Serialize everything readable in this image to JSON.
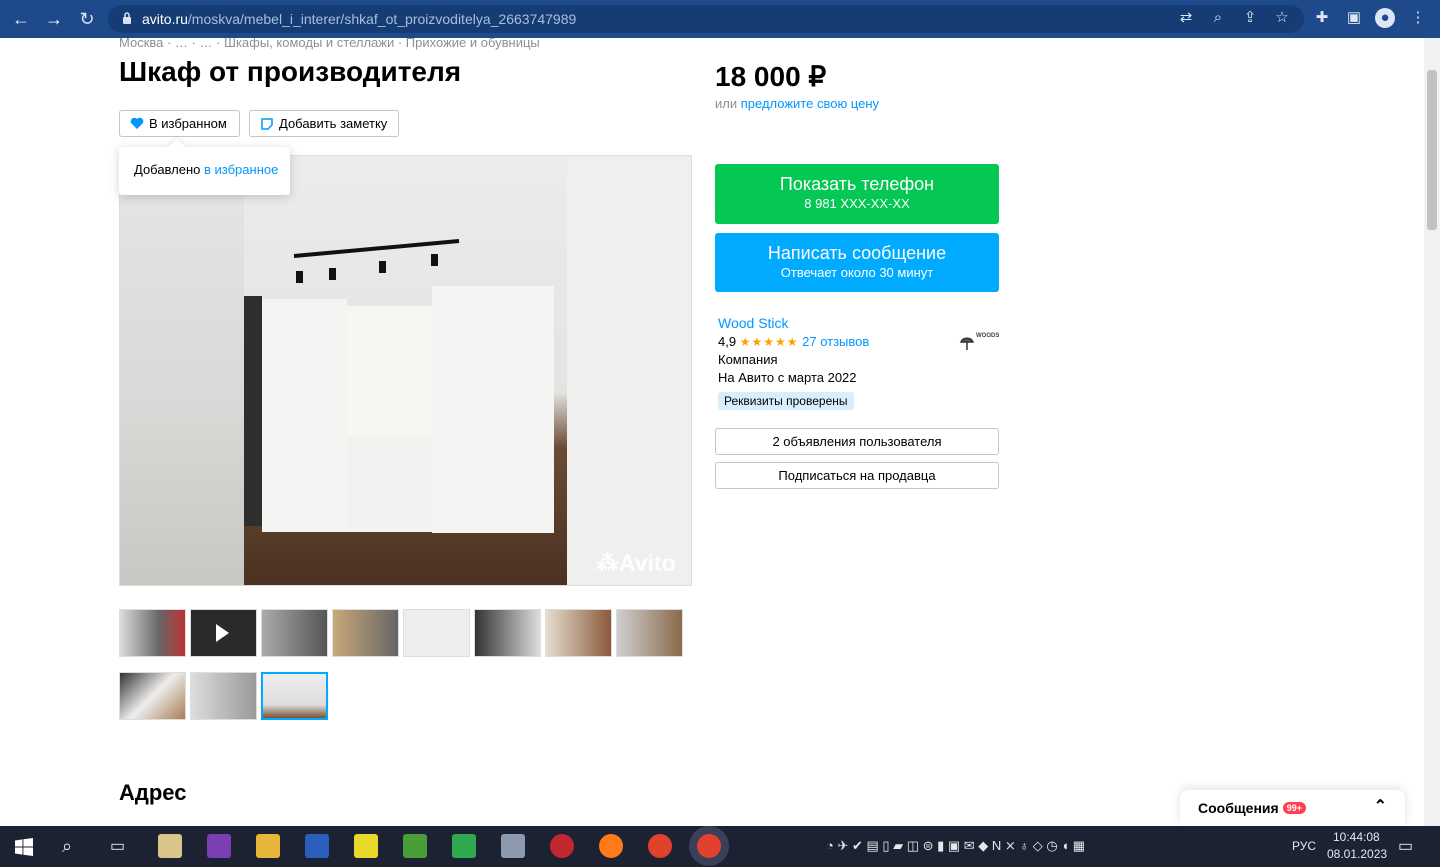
{
  "browser": {
    "url_host": "avito.ru",
    "url_path": "/moskva/mebel_i_interer/shkaf_ot_proizvoditelya_2663747989",
    "back_icon": "arrow-left-icon",
    "forward_icon": "arrow-right-icon",
    "reload_icon": "reload-icon"
  },
  "listing": {
    "breadcrumbs": "Москва · … · … · Шкафы, комоды и стеллажи · Прихожие и обувницы",
    "title": "Шкаф от производителя",
    "favorite_label": "В избранном",
    "note_label": "Добавить заметку",
    "tooltip_prefix": "Добавлено ",
    "tooltip_link": "в избранное",
    "watermark": "Avito",
    "thumbnail_count": 11,
    "selected_thumbnail": 11
  },
  "price": {
    "value": "18 000 ₽",
    "offer_prefix": "или ",
    "offer_link": "предложите свою цену"
  },
  "actions": {
    "phone_title": "Показать телефон",
    "phone_number": "8 981 XXX-XX-XX",
    "message_title": "Написать сообщение",
    "message_sub": "Отвечает около 30 минут",
    "ads_label": "2 объявления пользователя",
    "subscribe_label": "Подписаться на продавца"
  },
  "seller": {
    "name": "Wood Stick",
    "rating": "4,9",
    "stars": "★★★★★",
    "reviews": "27 отзывов",
    "type": "Компания",
    "since": "На Авито с марта 2022",
    "verified": "Реквизиты проверены",
    "logo_text": "WOODS"
  },
  "address": {
    "title": "Адрес"
  },
  "messages": {
    "label": "Сообщения",
    "count": "99+"
  },
  "taskbar": {
    "lang": "РУС",
    "time": "10:44:08",
    "date": "08.01.2023"
  },
  "colors": {
    "green": "#04c754",
    "blue": "#00aaff",
    "link": "#0097ff",
    "chrome": "#1e4a8c"
  }
}
